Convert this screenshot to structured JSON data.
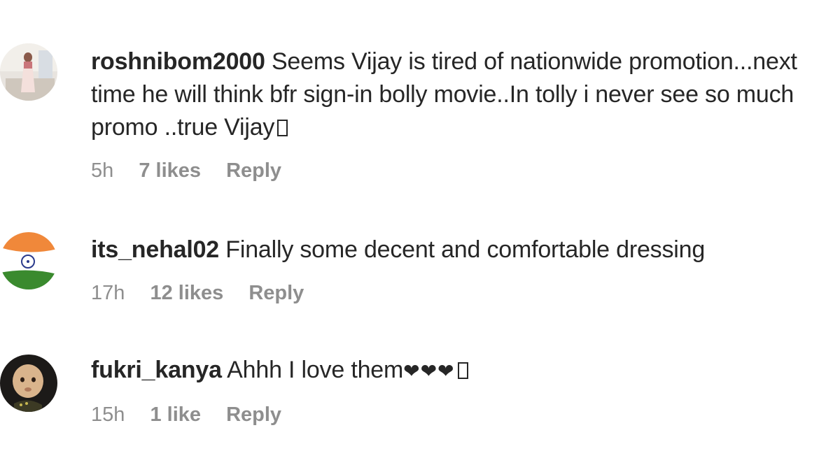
{
  "comments": [
    {
      "username": "roshnibom2000",
      "text": "Seems Vijay is tired of nationwide promotion...next time he will think bfr sign-in bolly movie..In tolly i never see so much promo ..true Vijay",
      "time": "5h",
      "likes": "7 likes",
      "reply": "Reply"
    },
    {
      "username": "its_nehal02",
      "text": "Finally some decent and comfortable dressing",
      "time": "17h",
      "likes": "12 likes",
      "reply": "Reply"
    },
    {
      "username": "fukri_kanya",
      "text": "Ahhh I love them",
      "hearts": "❤❤❤",
      "time": "15h",
      "likes": "1 like",
      "reply": "Reply"
    }
  ],
  "colors": {
    "text": "#262626",
    "meta": "#8e8e8e",
    "saffron": "#f0883a",
    "green": "#3a8a2e"
  },
  "icons": {
    "avatar_1": "photo-avatar",
    "avatar_2": "indian-flag-avatar",
    "avatar_3": "baby-photo-avatar"
  }
}
